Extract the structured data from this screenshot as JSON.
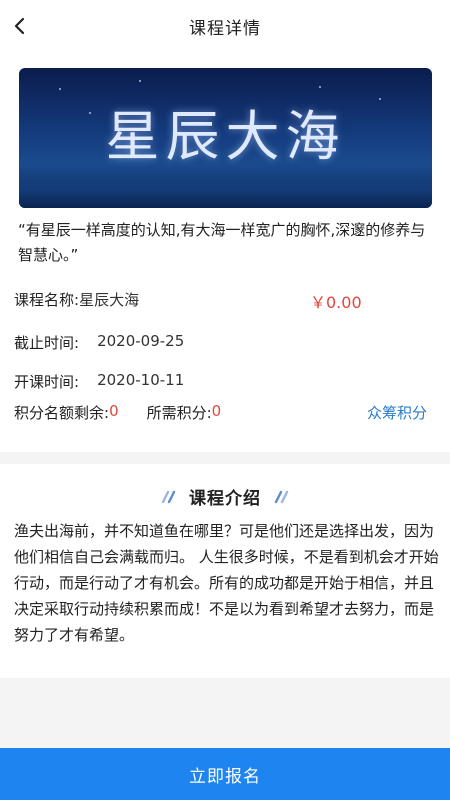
{
  "header": {
    "title": "课程详情"
  },
  "banner": {
    "text": "星辰大海"
  },
  "quote": "“有星辰一样高度的认知,有大海一样宽广的胸怀,深邃的修养与智慧心。”",
  "course": {
    "name_label": "课程名称: ",
    "name_value": "星辰大海",
    "price": "￥0.00",
    "deadline_label": "截止时间:",
    "deadline_value": "2020-09-25",
    "start_label": "开课时间:",
    "start_value": "2020-10-11",
    "quota_label": "积分名额剩余: ",
    "quota_value": "0",
    "points_label": "所需积分: ",
    "points_value": "0",
    "crowdfund_link": "众筹积分"
  },
  "intro": {
    "title": "课程介绍",
    "body": "渔夫出海前，并不知道鱼在哪里？可是他们还是选择出发，因为他们相信自己会满载而归。 人生很多时候，不是看到机会才开始行动，而是行动了才有机会。所有的成功都是开始于相信，并且决定采取行动持续积累而成！不是以为看到希望才去努力，而是努力了才有希望。"
  },
  "cta": {
    "label": "立即报名"
  },
  "colors": {
    "accent": "#1e84f0",
    "price": "#e0473d",
    "link": "#2a7cc9"
  }
}
